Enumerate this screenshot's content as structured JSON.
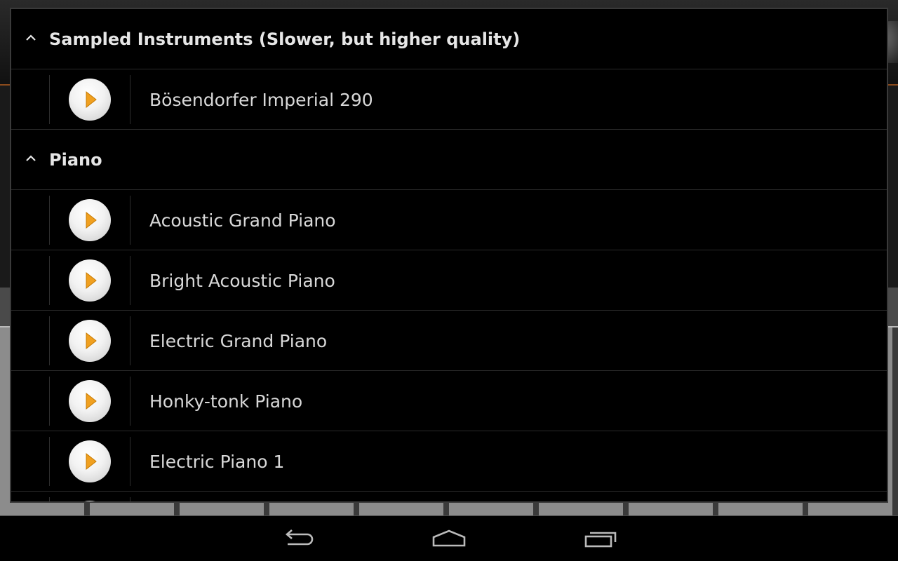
{
  "dialog": {
    "groups": [
      {
        "title": "Sampled Instruments (Slower, but higher quality)",
        "items": [
          {
            "label": "Bösendorfer Imperial 290"
          }
        ]
      },
      {
        "title": "Piano",
        "items": [
          {
            "label": "Acoustic Grand Piano"
          },
          {
            "label": "Bright Acoustic Piano"
          },
          {
            "label": "Electric Grand Piano"
          },
          {
            "label": "Honky-tonk Piano"
          },
          {
            "label": "Electric Piano 1"
          }
        ]
      }
    ]
  },
  "icons": {
    "group_toggle": "chevron-up-icon",
    "item_play": "play-icon",
    "nav_back": "back-icon",
    "nav_home": "home-icon",
    "nav_recents": "recent-apps-icon"
  },
  "colors": {
    "play_triangle": "#f0a020",
    "accent_line": "#8a4a1c"
  }
}
